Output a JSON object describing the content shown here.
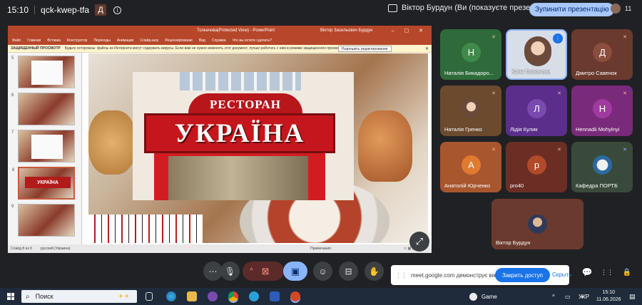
{
  "header": {
    "time": "15:10",
    "meeting_code": "qck-kwep-tfa",
    "badge_letter": "Д",
    "presenting_text": "Віктор Бурдун (Ви (показуєте презентацію))",
    "stop_label": "Зупинити презентацію",
    "participants_count": "11"
  },
  "powerpoint": {
    "title": "Толкачова(Protected View) - PowerPoint",
    "user": "Віктор Засильович Бурдун",
    "window_controls": "–  ▢  ✕",
    "menu": [
      "Файл",
      "Главная",
      "Вставка",
      "Конструктор",
      "Переходы",
      "Анимация",
      "Слайд-шоу",
      "Рецензирование",
      "Вид",
      "Справка",
      "Что вы хотите сделать?"
    ],
    "warning_bold": "ЗАЩИЩЕННЫЙ ПРОСМОТР",
    "warning_text": "Будьте осторожны: файлы из Интернета могут содержать вирусы. Если вам не нужно изменять этот документ, лучше работать с ним в режиме защищенного просмотра.",
    "enable_editing": "Разрешить редактирование",
    "close_x": "✕",
    "thumb_numbers": [
      "5",
      "6",
      "7",
      "8",
      "9"
    ],
    "thumb_sign": "УКРАЇНА",
    "slide_arch_text": "РЕСТОРАН",
    "slide_main_text": "УКРАЇНА",
    "status_slide": "Слайд 8 из 9",
    "status_lang": "русский (Украина)",
    "status_view": "Примечания",
    "status_zoom": "▭  ▦  ▣  ▤  –  +"
  },
  "tiles": [
    {
      "name": "Наталія Бикадоро...",
      "initial": "Н",
      "color": "#2f6b3a"
    },
    {
      "name": "Юлія Толкачова",
      "initial": "",
      "color": "#c9d4e2"
    },
    {
      "name": "Дмитро Савенок",
      "initial": "Д",
      "color": "#6b3a2e"
    },
    {
      "name": "Наталія Гренко",
      "initial": "",
      "color": "#6b4a2e"
    },
    {
      "name": "Лідія Кулик",
      "initial": "Л",
      "color": "#5a2e8a"
    },
    {
      "name": "Hennadii Mohylnyi",
      "initial": "Н",
      "color": "#7a2a7a"
    },
    {
      "name": "Анатолій Юрченко",
      "initial": "А",
      "color": "#a8562e"
    },
    {
      "name": "pro40",
      "initial": "р",
      "color": "#6b2e24"
    },
    {
      "name": "Кафедра ПОРТБ",
      "initial": "",
      "color": "#3a4a3a"
    },
    {
      "name": "Віктор Бурдун",
      "initial": "",
      "color": "#6b3a2e"
    }
  ],
  "controls": {
    "more": "⋯",
    "mic": "🎙",
    "chevron": "^",
    "cam": "⊠",
    "present": "▣",
    "emoji": "☺",
    "captions": "⊟",
    "hand": "✋",
    "chat": "💬",
    "activities": "⋮⋮",
    "lock": "🔒"
  },
  "share_bar": {
    "text": "meet.google.com демонструє вікно.",
    "allow": "Закрить доступ",
    "hide": "Скрыть"
  },
  "taskbar": {
    "search_placeholder": "Поиск",
    "game_label": "Game",
    "lang": "УКР",
    "time": "15:10",
    "date": "11.06.2026"
  }
}
